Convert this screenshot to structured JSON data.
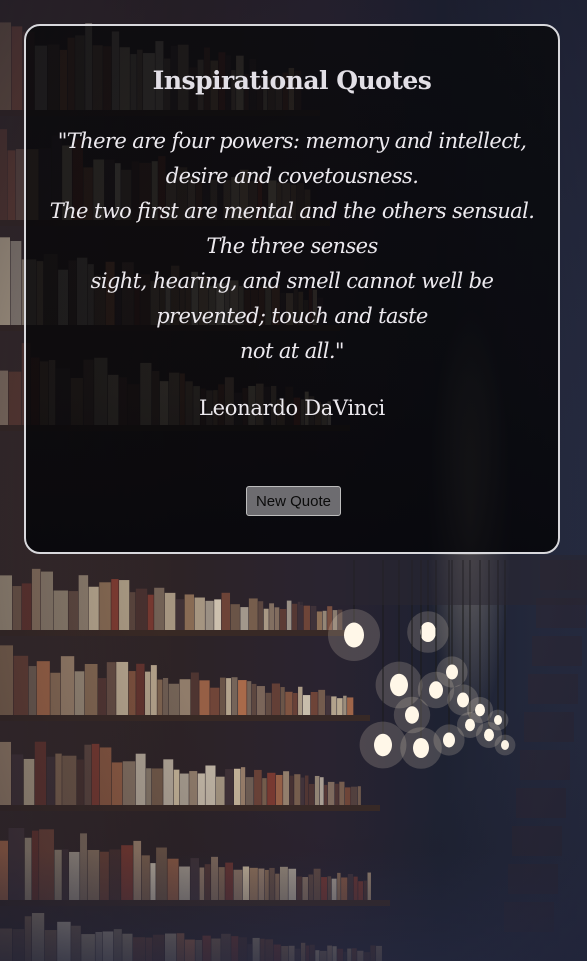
{
  "page": {
    "background_image": "library-bookshelves-with-hanging-bulbs"
  },
  "card": {
    "title": "Inspirational Quotes",
    "quote": "\"There are four powers: memory and intellect,\ndesire and covetousness.\nThe two first are mental and the others sensual.\nThe three senses\nsight, hearing, and smell cannot well be\nprevented; touch and taste\nnot at all.\"",
    "author": "Leonardo DaVinci",
    "new_quote_label": "New Quote"
  },
  "colors": {
    "card_background": "#0a0a0c",
    "card_border": "#d8d8dc",
    "text": "#ece9ee",
    "button_background": "#6d6c70"
  }
}
